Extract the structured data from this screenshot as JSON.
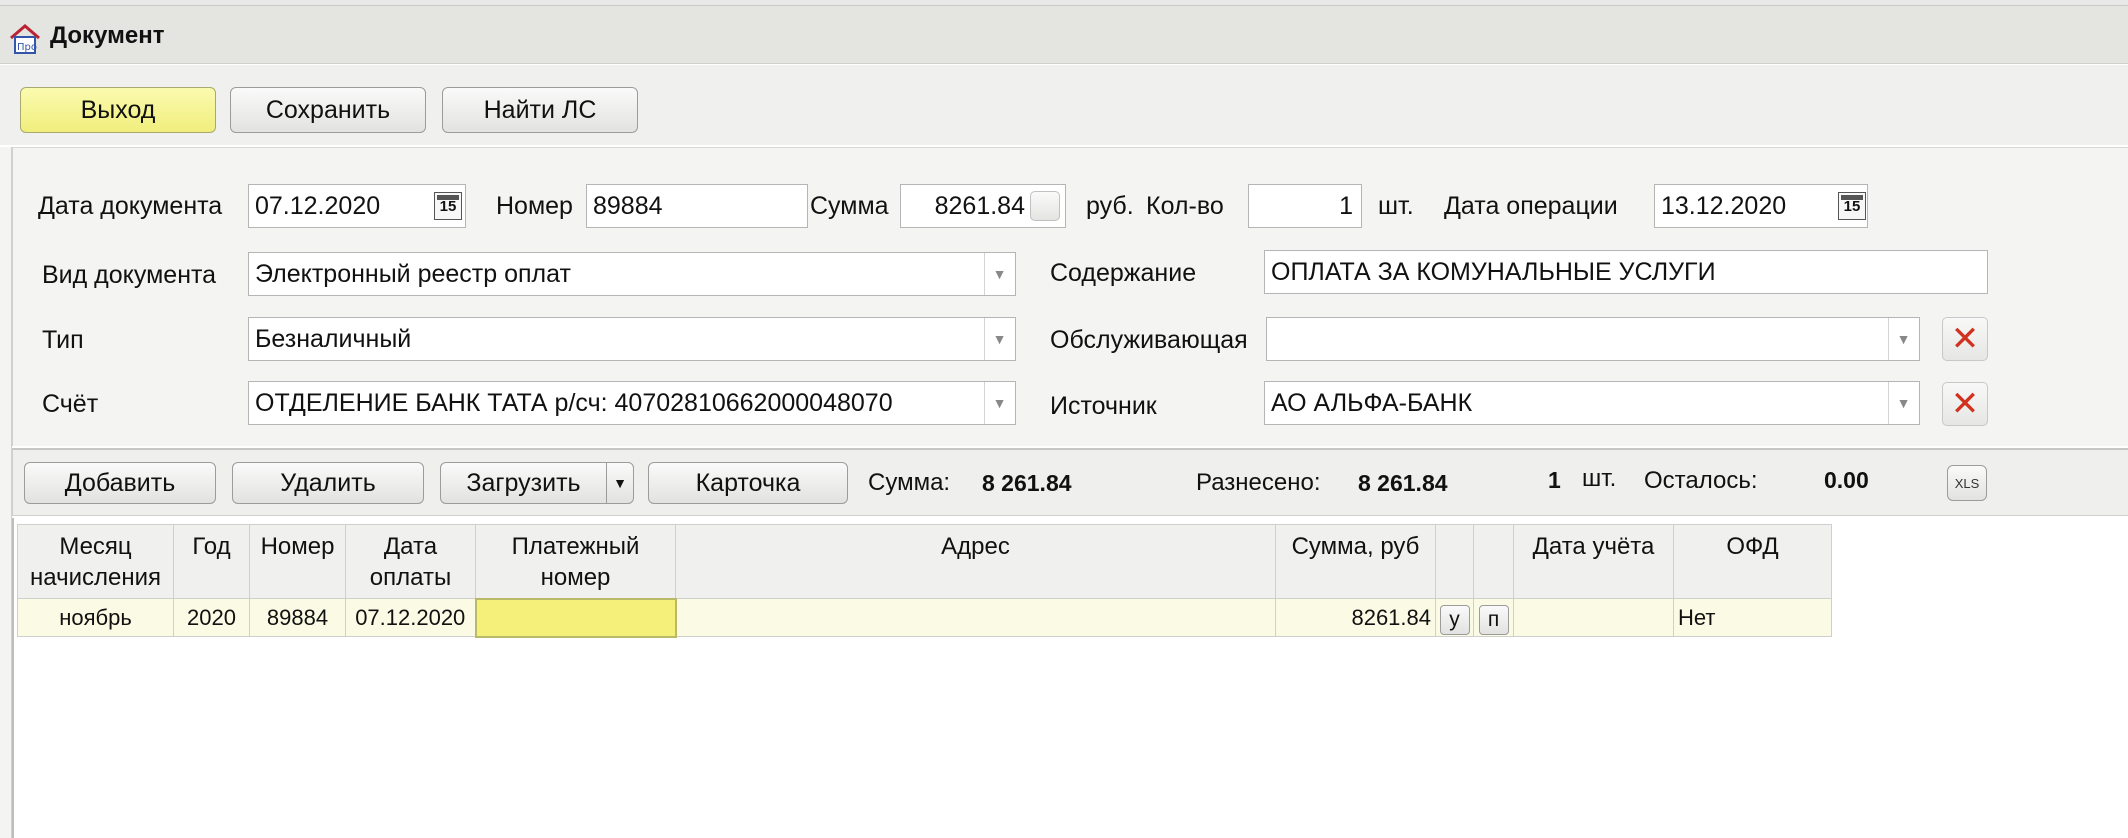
{
  "window": {
    "title": "Документ"
  },
  "toolbar": {
    "exit": "Выход",
    "save": "Сохранить",
    "find": "Найти ЛС"
  },
  "form": {
    "doc_date_label": "Дата документа",
    "doc_date": "07.12.2020",
    "number_label": "Номер",
    "number": "89884",
    "sum_label": "Сумма",
    "sum": "8261.84",
    "rub_label": "руб.",
    "qty_label": "Кол-во",
    "qty": "1",
    "pcs_label": "шт.",
    "op_date_label": "Дата операции",
    "op_date": "13.12.2020",
    "cal_glyph": "15",
    "doc_type_label": "Вид документа",
    "doc_type": "Электронный реестр оплат",
    "content_label": "Содержание",
    "content": "ОПЛАТА ЗА КОМУНАЛЬНЫЕ УСЛУГИ",
    "type_label": "Тип",
    "type": "Безналичный",
    "serving_label": "Обслуживающая",
    "serving": "",
    "account_label": "Счёт",
    "account": "ОТДЕЛЕНИЕ  БАНК ТАТА  р/сч: 40702810662000048070",
    "source_label": "Источник",
    "source": "АО  АЛЬФА-БАНК"
  },
  "actions": {
    "add": "Добавить",
    "delete": "Удалить",
    "load": "Загрузить",
    "card": "Карточка",
    "sum_label": "Сумма:",
    "sum_value": "8 261.84",
    "distributed_label": "Разнесено:",
    "distributed_value": "8 261.84",
    "count_value": "1",
    "count_unit": "шт.",
    "remaining_label": "Осталось:",
    "remaining_value": "0.00",
    "xls": "XLS"
  },
  "table": {
    "headers": [
      "Месяц начисления",
      "Год",
      "Номер",
      "Дата оплаты",
      "Платежный номер",
      "Адрес",
      "Сумма, руб",
      "",
      "",
      "Дата учёта",
      "ОФД"
    ],
    "rows": [
      {
        "month": "ноябрь",
        "year": "2020",
        "number": "89884",
        "pay_date": "07.12.2020",
        "pay_number": "",
        "address": "",
        "sum": "8261.84",
        "btn_u": "у",
        "btn_p": "п",
        "acc_date": "",
        "ofd": "Нет"
      }
    ]
  },
  "colors": {
    "accent_yellow": "#f4f07a",
    "delete_red": "#d0321f"
  }
}
